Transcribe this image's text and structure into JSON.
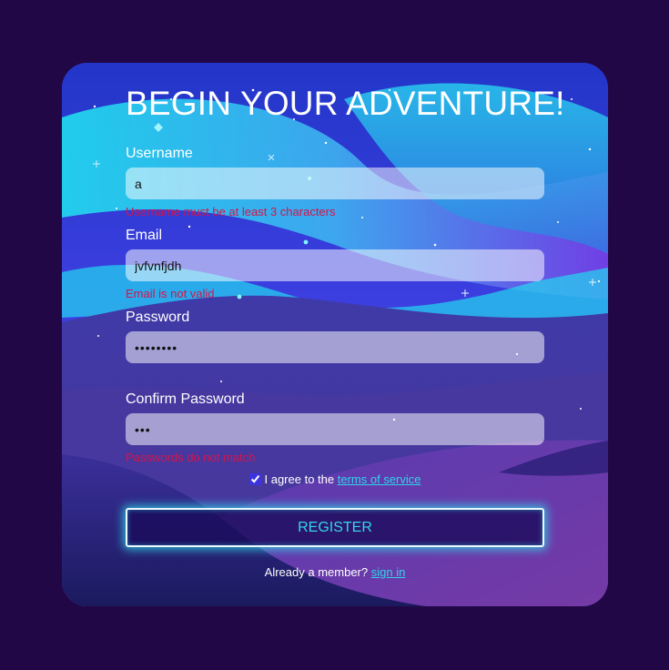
{
  "form": {
    "title": "BEGIN YOUR ADVENTURE!",
    "username": {
      "label": "Username",
      "value": "a",
      "error": "Username must be at least 3 characters"
    },
    "email": {
      "label": "Email",
      "value": "jvfvnfjdh",
      "error": "Email is not valid"
    },
    "password": {
      "label": "Password",
      "value": "••••••••"
    },
    "confirm_password": {
      "label": "Confirm Password",
      "value": "•••",
      "error": "Passwords do not match"
    },
    "agree": {
      "checked": true,
      "prefix": "I agree to the",
      "link": "terms of service"
    },
    "register_label": "REGISTER",
    "signin": {
      "prefix": "Already a member?",
      "link": "sign in"
    }
  },
  "colors": {
    "page_background": "#220747",
    "error": "#d3154a",
    "accent": "#35d6e6"
  }
}
